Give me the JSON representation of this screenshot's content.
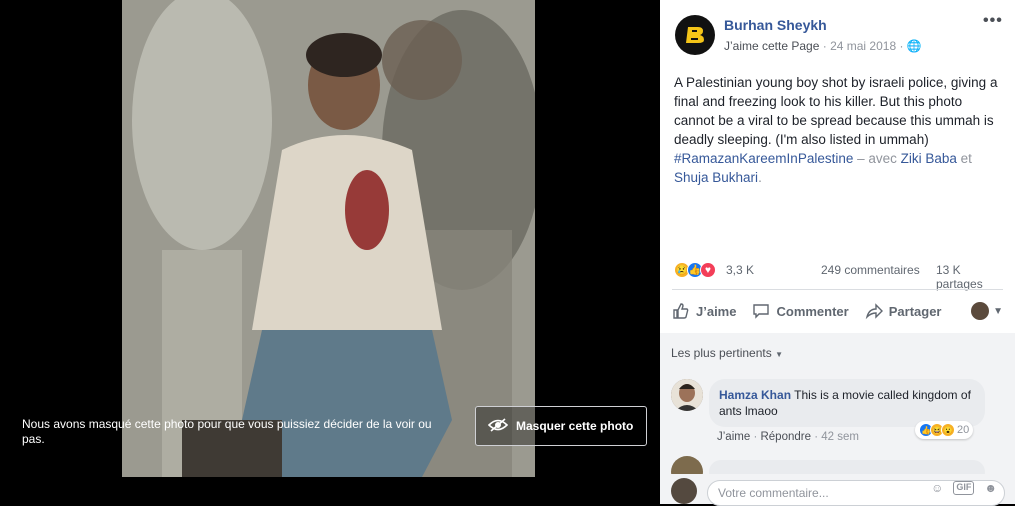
{
  "viewer": {
    "blur_note": "Nous avons masqué cette photo pour que vous puissiez décider de la voir ou pas.",
    "hide_button": "Masquer cette photo"
  },
  "post": {
    "page_name": "Burhan Sheykh",
    "like_page": "J’aime cette Page",
    "date": "24 mai 2018",
    "text_main": "A Palestinian young boy shot by israeli police, giving a final and freezing look to his killer. But this photo cannot be a viral to be spread because this ummah is deadly sleeping. (I'm also listed in ummah)",
    "hashtag": "#RamazanKareemInPalestine",
    "with_text": " – avec ",
    "tag1": "Ziki Baba",
    "and_text": " et ",
    "tag2": "Shuja Bukhari",
    "end": "."
  },
  "stats": {
    "reactions": "3,3 K",
    "comments": "249 commentaires",
    "shares": "13 K partages"
  },
  "actions": {
    "like": "J’aime",
    "comment": "Commenter",
    "share": "Partager"
  },
  "comments": {
    "sort_label": "Les plus pertinents",
    "items": [
      {
        "author": "Hamza Khan",
        "text": "This is a movie called kingdom of ants lmaoo",
        "like_link": "J’aime",
        "reply_link": "Répondre",
        "time": "42 sem",
        "reaction_count": "20"
      }
    ]
  },
  "composer": {
    "placeholder": "Votre commentaire..."
  },
  "colors": {
    "link": "#365899",
    "like_blue": "#1877f2",
    "love_red": "#f33e58",
    "haha_yellow": "#f7b125"
  }
}
